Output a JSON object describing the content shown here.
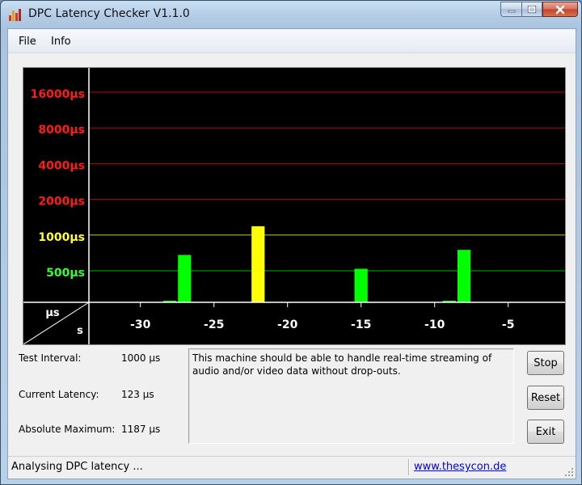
{
  "window": {
    "title": "DPC Latency Checker V1.1.0",
    "icon": "app-bars-icon"
  },
  "menu": [
    "File",
    "Info"
  ],
  "chart_data": {
    "type": "bar",
    "y_scale": "log2",
    "y_tick_labels": [
      "16000µs",
      "8000µs",
      "4000µs",
      "2000µs",
      "1000µs",
      "500µs"
    ],
    "y_tick_values": [
      16000,
      8000,
      4000,
      2000,
      1000,
      500
    ],
    "y_tick_colors": [
      "#ff1b1b",
      "#ff1b1b",
      "#ff1b1b",
      "#ff1b1b",
      "#ffff33",
      "#33ff33"
    ],
    "gridline_colors": [
      "#c00000",
      "#c00000",
      "#c00000",
      "#c00000",
      "#c8c800",
      "#00b000"
    ],
    "corner_labels": {
      "y_unit": "µs",
      "x_unit": "s"
    },
    "x_tick_labels": [
      "-30",
      "-25",
      "-20",
      "-15",
      "-10",
      "-5"
    ],
    "x_tick_values": [
      -30,
      -25,
      -20,
      -15,
      -10,
      -5
    ],
    "x_range": [
      -33,
      0
    ],
    "bar_colors": {
      "normal": "#00ff00",
      "warning": "#ffff00"
    },
    "values": [
      150,
      150,
      160,
      240,
      150,
      280,
      680,
      210,
      230,
      150,
      170,
      1187,
      150,
      210,
      160,
      150,
      150,
      250,
      520,
      160,
      240,
      150,
      260,
      150,
      280,
      750,
      150,
      130,
      130,
      120,
      130,
      130,
      110
    ],
    "grid": true
  },
  "info": {
    "test_interval_label": "Test Interval:",
    "test_interval_value": "1000 µs",
    "current_latency_label": "Current Latency:",
    "current_latency_value": "123 µs",
    "absolute_maximum_label": "Absolute Maximum:",
    "absolute_maximum_value": "1187 µs"
  },
  "message": "This machine should be able to handle real-time streaming of audio and/or video data without drop-outs.",
  "buttons": {
    "stop": "Stop",
    "reset": "Reset",
    "exit": "Exit"
  },
  "status": {
    "text": "Analysing DPC latency ...",
    "link": "www.thesycon.de"
  }
}
